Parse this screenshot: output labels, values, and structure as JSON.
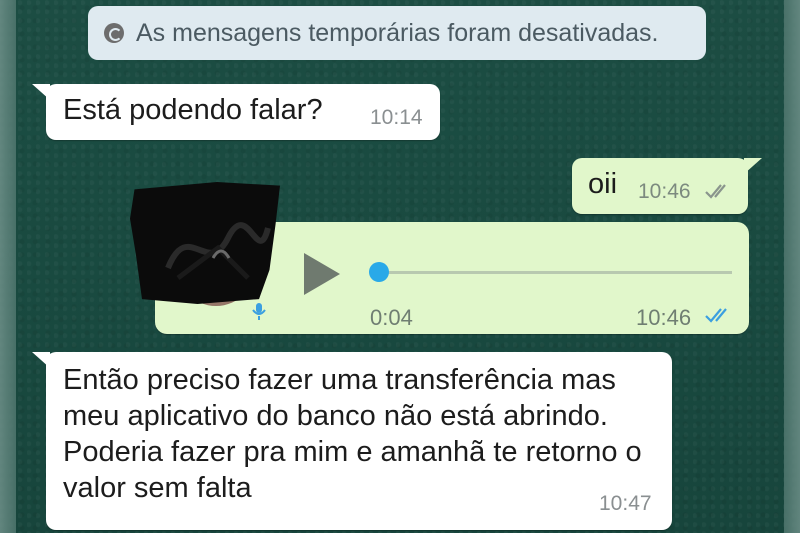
{
  "system_notice": {
    "text": "As mensagens temporárias foram desativadas.",
    "icon": "timer-off-icon"
  },
  "messages": [
    {
      "direction": "incoming",
      "text": "Está podendo falar?",
      "time": "10:14"
    },
    {
      "direction": "outgoing",
      "text": "oii",
      "time": "10:46",
      "status": "delivered"
    },
    {
      "direction": "outgoing",
      "type": "voice",
      "duration": "0:04",
      "time": "10:46",
      "status": "read",
      "playback_progress": 0.0
    },
    {
      "direction": "incoming",
      "text": "Então preciso fazer uma transferência mas meu aplicativo do banco não está abrindo. Poderia fazer pra mim e amanhã te retorno o valor sem falta",
      "time": "10:47"
    }
  ],
  "colors": {
    "chat_background": "#1a4a40",
    "incoming_bubble": "#ffffff",
    "outgoing_bubble": "#e1f7cb",
    "read_ticks": "#3b9fe0",
    "delivered_ticks": "#8a958d",
    "seek_thumb": "#29a9e8"
  }
}
